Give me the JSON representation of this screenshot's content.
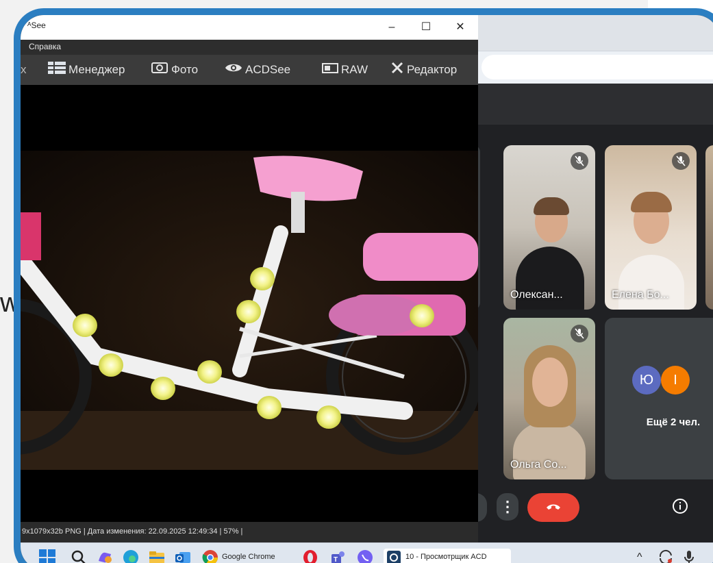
{
  "outer_stray_char": "w",
  "acdsee": {
    "title": "ᴬSee",
    "window_buttons": {
      "minimize": "–",
      "maximize": "☐",
      "close": "✕"
    },
    "menu": {
      "help": "Справка"
    },
    "toolbar": {
      "manager": "Менеджер",
      "photo": "Фото",
      "acdsee": "ACDSee",
      "raw": "RAW",
      "editor": "Редактор"
    },
    "status": "9x1079x32b PNG | Дата изменения: 22.09.2025 12:49:34 | 57% |"
  },
  "meet": {
    "participants": [
      {
        "name": "Олексан...",
        "muted": true
      },
      {
        "name": "Елена Бо...",
        "muted": true
      },
      {
        "name": "Ольга Со...",
        "muted": true
      }
    ],
    "more": {
      "avatars": [
        {
          "letter": "Ю",
          "color": "#5c6bc0"
        },
        {
          "letter": "І",
          "color": "#f57c00"
        }
      ],
      "label": "Ещё 2 чел."
    },
    "controls": {
      "more_glyph": "⋮",
      "info_glyph": "i"
    }
  },
  "taskbar": {
    "chrome_label": "Google Chrome",
    "acd_label": "10 - Просмотрщик ACD",
    "tray_chevron": "^"
  },
  "colors": {
    "frame": "#2b7ec1",
    "hangup": "#ea4335",
    "meet_bg": "#202124"
  }
}
